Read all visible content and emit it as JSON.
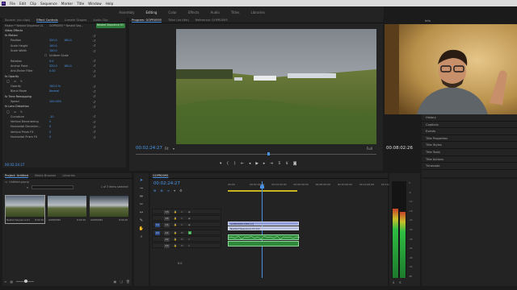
{
  "menu": {
    "logo": "Pr",
    "items": [
      "File",
      "Edit",
      "Clip",
      "Sequence",
      "Marker",
      "Title",
      "Window",
      "Help"
    ]
  },
  "workspaces": [
    "Assembly",
    "Editing",
    "Color",
    "Effects",
    "Audio",
    "Titles",
    "Libraries"
  ],
  "active_workspace": "Editing",
  "source_panel": {
    "tabs": [
      "Source: (no clips)",
      "Effect Controls",
      "Lumetri Scopes",
      "Audio Clip"
    ],
    "active_tab": "Effect Controls",
    "breadcrumb": "Master * Nested Sequence 01",
    "clip_path": "GOPR0095 * Nested Seq...",
    "clip_label": "Nested Sequence 01",
    "section_video": "Video Effects",
    "rows": [
      {
        "name": "fx Motion",
        "type": "hdr"
      },
      {
        "name": "Position",
        "v1": "320.0",
        "v2": "180.0"
      },
      {
        "name": "Scale Height",
        "v1": "100.0"
      },
      {
        "name": "Scale Width",
        "v1": "100.0"
      },
      {
        "name": "Uniform Scale",
        "type": "check"
      },
      {
        "name": "Rotation",
        "v1": "0.0"
      },
      {
        "name": "Anchor Point",
        "v1": "320.0",
        "v2": "180.0"
      },
      {
        "name": "Anti-flicker Filter",
        "v1": "0.00"
      },
      {
        "name": "fx Opacity",
        "type": "hdr"
      },
      {
        "name": "",
        "type": "masks"
      },
      {
        "name": "Opacity",
        "v1": "100.0 %"
      },
      {
        "name": "Blend Mode",
        "v1": "Normal"
      },
      {
        "name": "fx Time Remapping",
        "type": "hdr"
      },
      {
        "name": "Speed",
        "v1": "100.00%"
      },
      {
        "name": "fx Lens Distortion",
        "type": "hdr"
      },
      {
        "name": "",
        "type": "masks"
      },
      {
        "name": "Curvature",
        "v1": "-10"
      },
      {
        "name": "Vertical Decentering",
        "v1": "0"
      },
      {
        "name": "Horizontal Decenter...",
        "v1": "0"
      },
      {
        "name": "Vertical Prism FX",
        "v1": "0"
      },
      {
        "name": "Horizontal Prism FX",
        "v1": "0"
      }
    ],
    "timecode": "00:02:24:27"
  },
  "program": {
    "tabs": [
      "Program: GOPR0095",
      "Titler (no title)",
      "Reference: GOPR0095"
    ],
    "timecode": "00:02:24:27",
    "fit": "Fit",
    "full": "Full",
    "duration": "00:08:02:26"
  },
  "right_panels": {
    "info_label": "Info",
    "items": [
      "History",
      "Captions",
      "Events",
      "Title Properties",
      "Title Styles",
      "Title Tools",
      "Title Actions",
      "Timecode"
    ]
  },
  "project": {
    "tabs": [
      "Project: Untitled",
      "Media Browser",
      "Libraries"
    ],
    "project_file": "Untitled.prproj",
    "search_placeholder": "",
    "selection": "1 of 3 items selected",
    "items": [
      {
        "name": "Nested Sequence 01",
        "duration": "8:02:26"
      },
      {
        "name": "GOPR0095",
        "duration": "8:02:26"
      },
      {
        "name": "GOPR0095",
        "duration": "8:02:26"
      }
    ]
  },
  "timeline": {
    "tab": "GOPR0095",
    "timecode": "00:02:24:27",
    "ruler": [
      "00:00",
      "00:02:00:00",
      "00:04:00:00",
      "00:06:00:00",
      "00:08:00:00",
      "00:10:00:00",
      "00:12:00:00",
      "00:14:00:00"
    ],
    "tracks": [
      "V3",
      "V2",
      "V1",
      "A1",
      "A2",
      "A3"
    ],
    "source_tracks": [
      "V1",
      "A1"
    ],
    "clips": {
      "v2": "GOPR0095.MP4 [V]",
      "v1": "Nested Sequence 01 [V]"
    },
    "master": "0.0"
  },
  "meter": {
    "scale": [
      "0",
      "-6",
      "-12",
      "-18",
      "-24",
      "-30",
      "-36",
      "-42",
      "-48",
      "-54",
      "dB"
    ],
    "levels": [
      0.72,
      0.68
    ],
    "labels": [
      "S",
      "S"
    ]
  },
  "colors": {
    "accent": "#4a90e2",
    "audio_clip": "#2e8a3a",
    "video_clip": "#7a88c8",
    "playhead": "#4a90e2"
  }
}
